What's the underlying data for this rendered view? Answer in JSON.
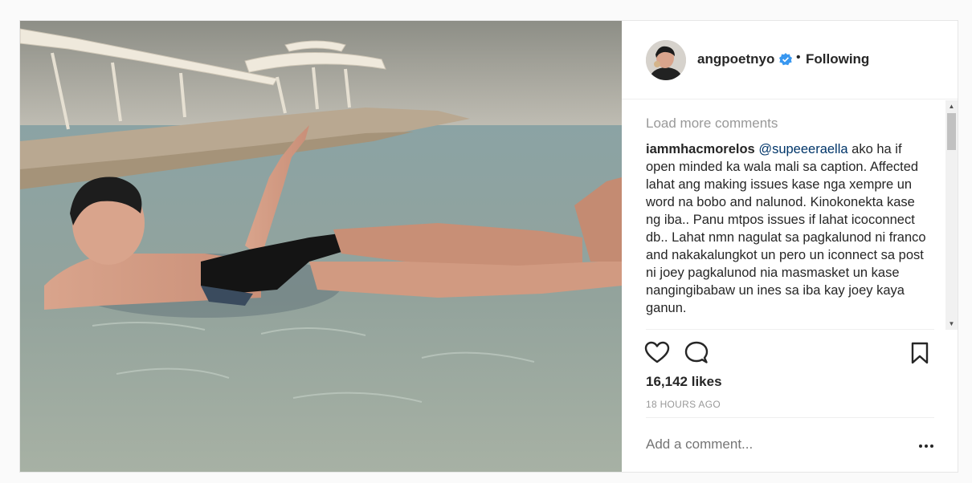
{
  "post": {
    "photo": {
      "description_icon": "photo-image"
    },
    "header": {
      "username": "angpoetnyo",
      "separator": "•",
      "follow_label": "Following",
      "verified_color": "#3897f0"
    },
    "comments": {
      "load_more": "Load more comments",
      "items": [
        {
          "author": "iammhacmorelos",
          "mention": "@supeeeraella",
          "text": " ako ha if open minded ka wala mali sa caption. Affected lahat ang making issues kase nga xempre un word na bobo and nalunod. Kinokonekta kase ng iba.. Panu mtpos issues if lahat icoconnect db.. Lahat nmn nagulat sa pagkalunod ni franco and nakakalungkot un pero un iconnect sa post ni joey pagkalunod nia masmasket un kase nangingibabaw un ines sa iba kay joey kaya ganun."
        }
      ]
    },
    "likes": "16,142 likes",
    "timestamp": "18 HOURS AGO",
    "add_comment_placeholder": "Add a comment...",
    "icons": {
      "like": "heart-icon",
      "comment": "speech-bubble-icon",
      "save": "bookmark-icon",
      "more": "more-options-icon"
    }
  }
}
